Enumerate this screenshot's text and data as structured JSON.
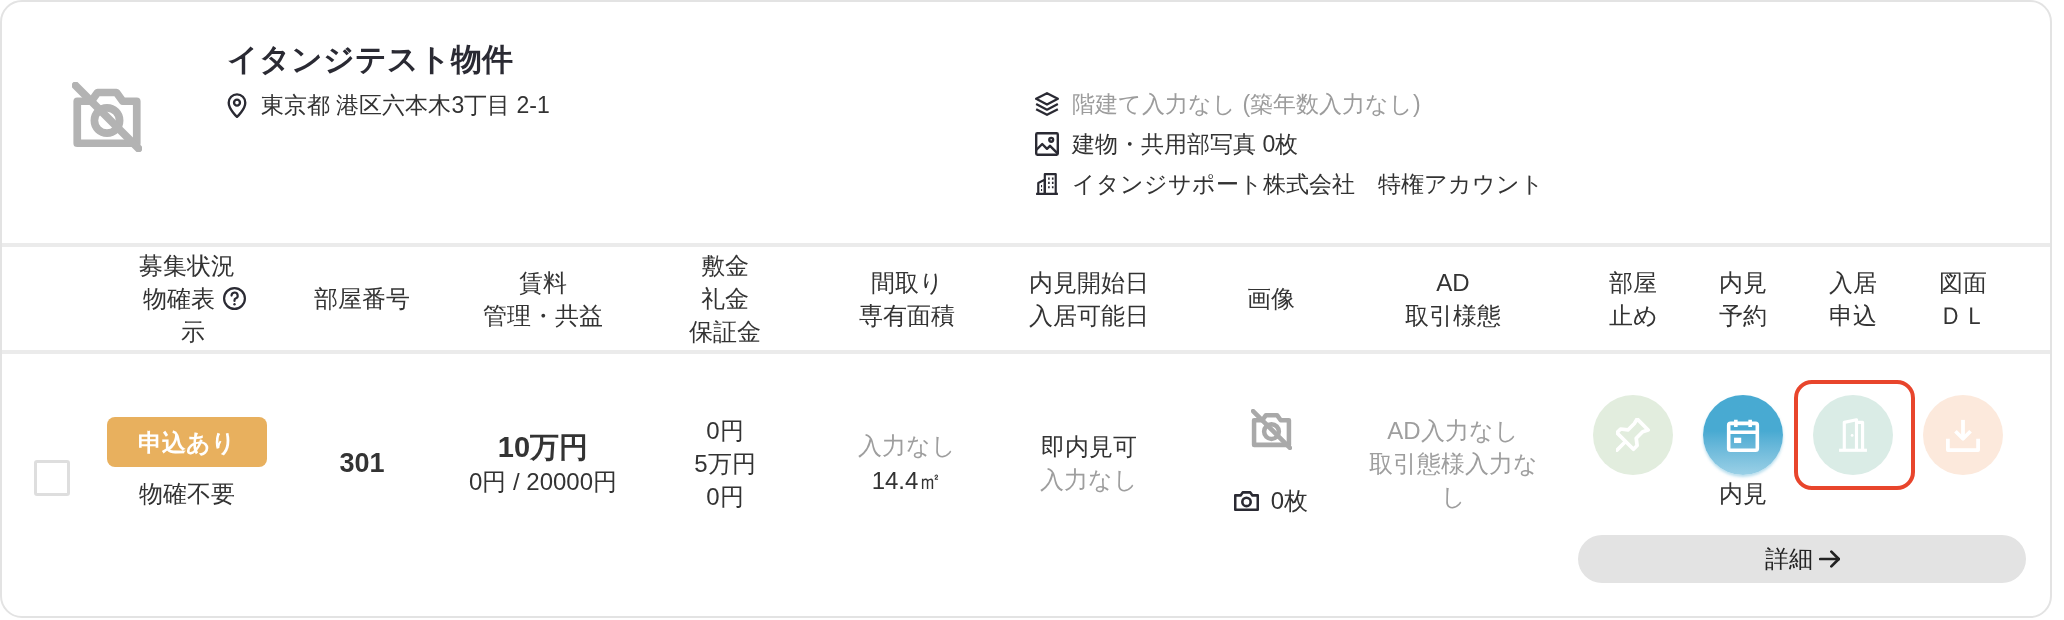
{
  "property": {
    "title": "イタンジテスト物件",
    "address": "東京都 港区六本木3丁目 2-1",
    "info": [
      {
        "kind": "floors",
        "text": "階建て入力なし (築年数入力なし)",
        "muted": true
      },
      {
        "kind": "photos",
        "text": "建物・共用部写真 0枚",
        "muted": false
      },
      {
        "kind": "company",
        "text": "イタンジサポート株式会社　特権アカウント",
        "muted": false
      }
    ]
  },
  "columns": [
    {
      "lines": [
        "募集状況",
        "物確表示"
      ],
      "help": true
    },
    {
      "lines": [
        "部屋番号"
      ]
    },
    {
      "lines": [
        "賃料",
        "管理・共益"
      ]
    },
    {
      "lines": [
        "敷金",
        "礼金",
        "保証金"
      ]
    },
    {
      "lines": [
        "間取り",
        "専有面積"
      ]
    },
    {
      "lines": [
        "内見開始日",
        "入居可能日"
      ]
    },
    {
      "lines": [
        "画像"
      ]
    },
    {
      "lines": [
        "AD",
        "取引様態"
      ]
    },
    {
      "lines": [
        "部屋止め"
      ]
    },
    {
      "lines": [
        "内見予約"
      ]
    },
    {
      "lines": [
        "入居申込"
      ]
    },
    {
      "lines": [
        "図面ＤＬ"
      ]
    }
  ],
  "rows": [
    {
      "checked": false,
      "status_badge": "申込あり",
      "confirmation": "物確不要",
      "room_number": "301",
      "rent": "10万円",
      "fees": "0円 / 20000円",
      "deposits": [
        "0円",
        "5万円",
        "0円"
      ],
      "layout": {
        "text": "入力なし",
        "empty": true
      },
      "area": {
        "text": "14.4㎡",
        "empty": false
      },
      "viewing_start": {
        "text": "即内見可",
        "empty": false
      },
      "move_in": {
        "text": "入力なし",
        "empty": true
      },
      "photo_count": "0枚",
      "ad": {
        "text": "AD入力なし",
        "empty": true
      },
      "transaction_type": {
        "text": "取引態様入力なし",
        "empty": true
      },
      "actions": [
        {
          "kind": "pin",
          "enabled": false
        },
        {
          "kind": "calendar",
          "enabled": true,
          "label": "内見"
        },
        {
          "kind": "door",
          "enabled": false,
          "highlighted": true
        },
        {
          "kind": "download",
          "enabled": false
        }
      ],
      "detail_button": "詳細"
    }
  ]
}
